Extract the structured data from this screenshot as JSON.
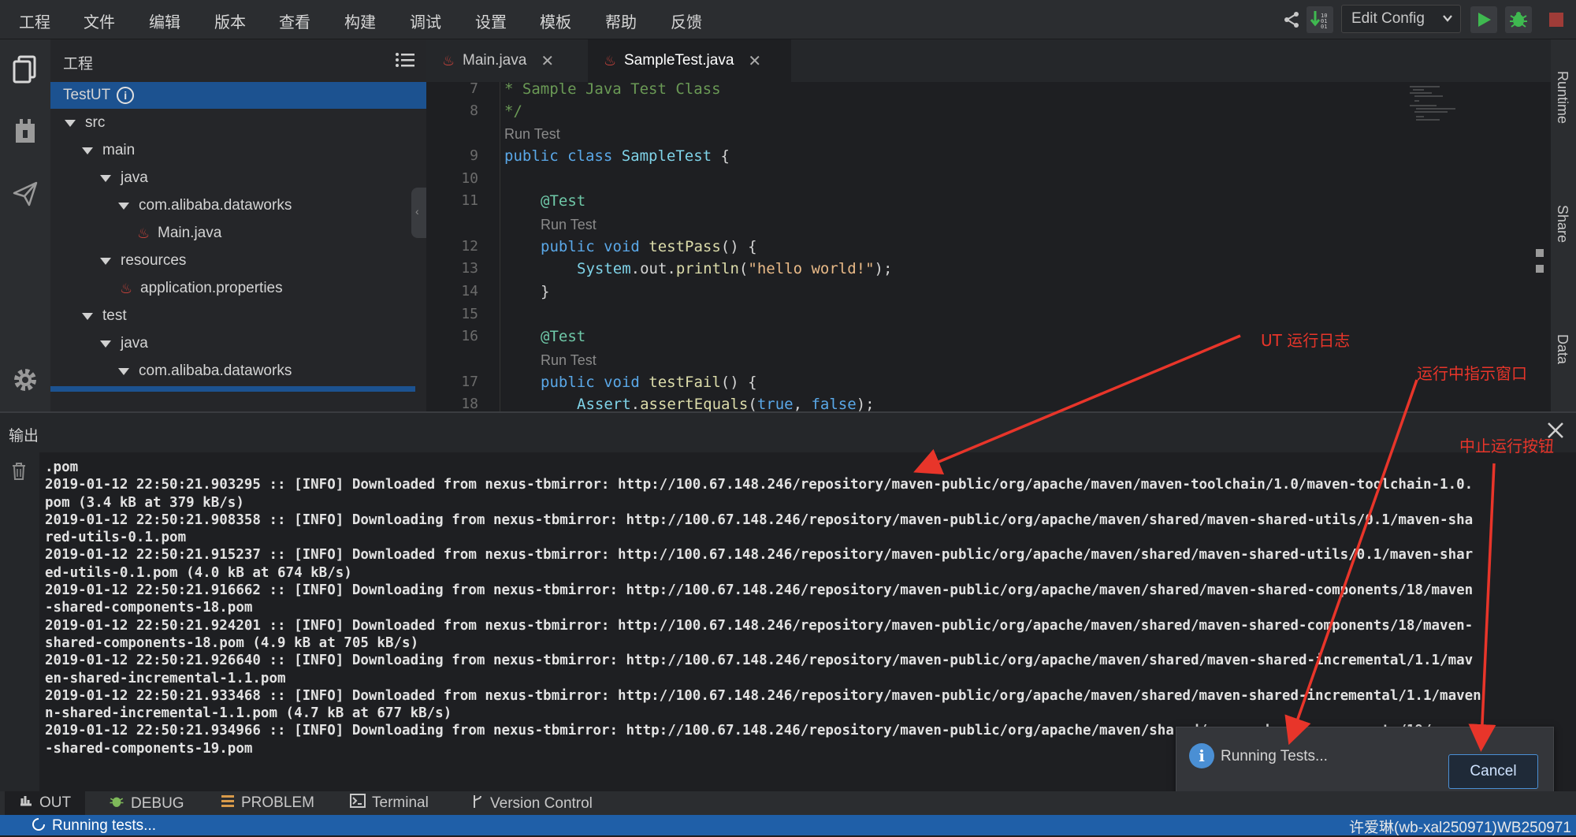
{
  "menu": [
    "工程",
    "文件",
    "编辑",
    "版本",
    "查看",
    "构建",
    "调试",
    "设置",
    "模板",
    "帮助",
    "反馈"
  ],
  "toolbar": {
    "edit_config": "Edit Config"
  },
  "sidebar": {
    "title": "工程",
    "items": [
      {
        "label": "TestUT",
        "selected": true
      },
      {
        "label": "src"
      },
      {
        "label": "main"
      },
      {
        "label": "java"
      },
      {
        "label": "com.alibaba.dataworks"
      },
      {
        "label": "Main.java"
      },
      {
        "label": "resources"
      },
      {
        "label": "application.properties"
      },
      {
        "label": "test"
      },
      {
        "label": "java"
      },
      {
        "label": "com.alibaba.dataworks"
      }
    ]
  },
  "tabs": [
    {
      "label": "Main.java",
      "active": false
    },
    {
      "label": "SampleTest.java",
      "active": true
    }
  ],
  "editor": {
    "line_numbers": [
      "7",
      "8",
      "9",
      "10",
      "11",
      "12",
      "13",
      "14",
      "15",
      "16",
      "17",
      "18"
    ],
    "run_test": "Run Test",
    "lines": {
      "l7": "* Sample Java Test Class",
      "l8": "*/",
      "l9a": "public class ",
      "l9b": "SampleTest",
      "l9c": " {",
      "l11": "@Test",
      "l12a": "public void ",
      "l12b": "testPass",
      "l12c": "() {",
      "l13a": "System",
      "l13b": ".out.",
      "l13c": "println",
      "l13d": "(",
      "l13e": "\"hello world!\"",
      "l13f": ");",
      "l14": "}",
      "l16": "@Test",
      "l17a": "public void ",
      "l17b": "testFail",
      "l17c": "() {",
      "l18a": "Assert",
      "l18b": ".",
      "l18c": "assertEquals",
      "l18d": "(",
      "l18e": "true",
      "l18f": ", ",
      "l18g": "false",
      "l18h": ");"
    }
  },
  "right_panel": [
    "Runtime",
    "Share",
    "Data"
  ],
  "output": {
    "title": "输出",
    "log": ".pom\n2019-01-12 22:50:21.903295 :: [INFO] Downloaded from nexus-tbmirror: http://100.67.148.246/repository/maven-public/org/apache/maven/maven-toolchain/1.0/maven-toolchain-1.0.\npom (3.4 kB at 379 kB/s)\n2019-01-12 22:50:21.908358 :: [INFO] Downloading from nexus-tbmirror: http://100.67.148.246/repository/maven-public/org/apache/maven/shared/maven-shared-utils/0.1/maven-sha\nred-utils-0.1.pom\n2019-01-12 22:50:21.915237 :: [INFO] Downloaded from nexus-tbmirror: http://100.67.148.246/repository/maven-public/org/apache/maven/shared/maven-shared-utils/0.1/maven-shar\ned-utils-0.1.pom (4.0 kB at 674 kB/s)\n2019-01-12 22:50:21.916662 :: [INFO] Downloading from nexus-tbmirror: http://100.67.148.246/repository/maven-public/org/apache/maven/shared/maven-shared-components/18/maven\n-shared-components-18.pom\n2019-01-12 22:50:21.924201 :: [INFO] Downloaded from nexus-tbmirror: http://100.67.148.246/repository/maven-public/org/apache/maven/shared/maven-shared-components/18/maven-\nshared-components-18.pom (4.9 kB at 705 kB/s)\n2019-01-12 22:50:21.926640 :: [INFO] Downloading from nexus-tbmirror: http://100.67.148.246/repository/maven-public/org/apache/maven/shared/maven-shared-incremental/1.1/mav\nen-shared-incremental-1.1.pom\n2019-01-12 22:50:21.933468 :: [INFO] Downloaded from nexus-tbmirror: http://100.67.148.246/repository/maven-public/org/apache/maven/shared/maven-shared-incremental/1.1/maven\nn-shared-incremental-1.1.pom (4.7 kB at 677 kB/s)\n2019-01-12 22:50:21.934966 :: [INFO] Downloading from nexus-tbmirror: http://100.67.148.246/repository/maven-public/org/apache/maven/shared/maven-shared-components/19/maven\n-shared-components-19.pom"
  },
  "bottom_tabs": [
    "OUT",
    "DEBUG",
    "PROBLEM",
    "Terminal",
    "Version Control"
  ],
  "status": {
    "left": "Running tests...",
    "right": "许爱琳(wb-xal250971)WB250971"
  },
  "toast": {
    "message": "Running Tests...",
    "cancel": "Cancel"
  },
  "annotations": {
    "log": "UT 运行日志",
    "window": "运行中指示窗口",
    "stop": "中止运行按钮"
  },
  "colors": {
    "accent": "#1f5fa8",
    "selected": "#1c5290",
    "annotation": "#e8352a",
    "run_green": "#3fb950"
  }
}
